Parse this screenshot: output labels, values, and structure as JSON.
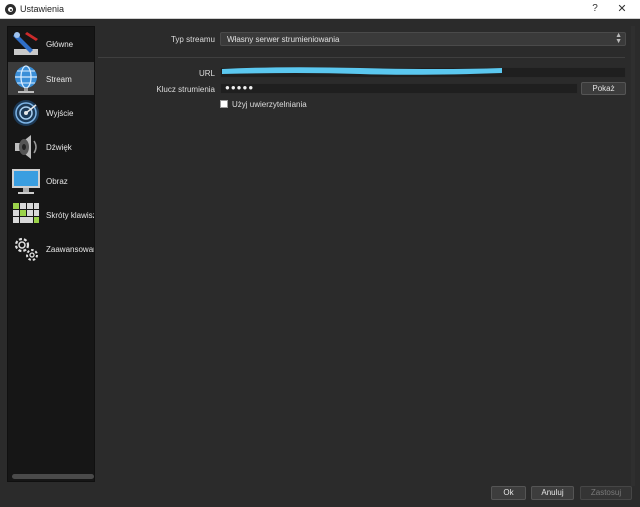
{
  "window": {
    "title": "Ustawienia",
    "help_symbol": "?",
    "close_symbol": "✕"
  },
  "sidebar": {
    "items": [
      {
        "label": "Główne",
        "icon": "wrench-screwdriver-icon"
      },
      {
        "label": "Stream",
        "icon": "globe-icon"
      },
      {
        "label": "Wyjście",
        "icon": "satellite-dish-icon"
      },
      {
        "label": "Dźwięk",
        "icon": "speaker-icon"
      },
      {
        "label": "Obraz",
        "icon": "monitor-icon"
      },
      {
        "label": "Skróty klawiszo",
        "icon": "keyboard-icon"
      },
      {
        "label": "Zaawansowane",
        "icon": "gears-icon"
      }
    ],
    "active_index": 1
  },
  "stream": {
    "type_label": "Typ streamu",
    "type_value": "Własny serwer strumieniowania",
    "url_label": "URL",
    "key_label": "Klucz strumienia",
    "key_value": "●●●●●",
    "show_label": "Pokaż",
    "auth_label": "Użyj uwierzytelniania"
  },
  "buttons": {
    "ok": "Ok",
    "cancel": "Anuluj",
    "apply": "Zastosuj"
  },
  "colors": {
    "background": "#2b2b2b",
    "sidebar": "#161616",
    "redaction": "#5bc8f0"
  }
}
